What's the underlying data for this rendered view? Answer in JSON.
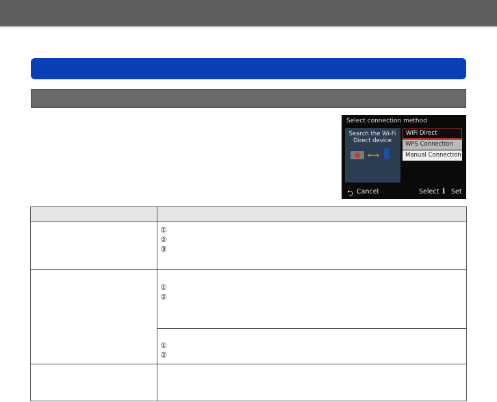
{
  "camera_screen": {
    "title": "Select connection method",
    "panel_text": "Search the Wi-Fi Direct device",
    "options": [
      "WiFi Direct",
      "WPS Connection",
      "Manual Connection"
    ],
    "cancel_label": "Cancel",
    "select_label": "Select",
    "set_label": "Set"
  },
  "table": {
    "marker_1": "①",
    "marker_2": "②",
    "marker_3": "③"
  },
  "colors": {
    "top_bar": "#5f5f5f",
    "section_bar": "#0a3fb8",
    "sub_bar": "#6a6a6a"
  }
}
